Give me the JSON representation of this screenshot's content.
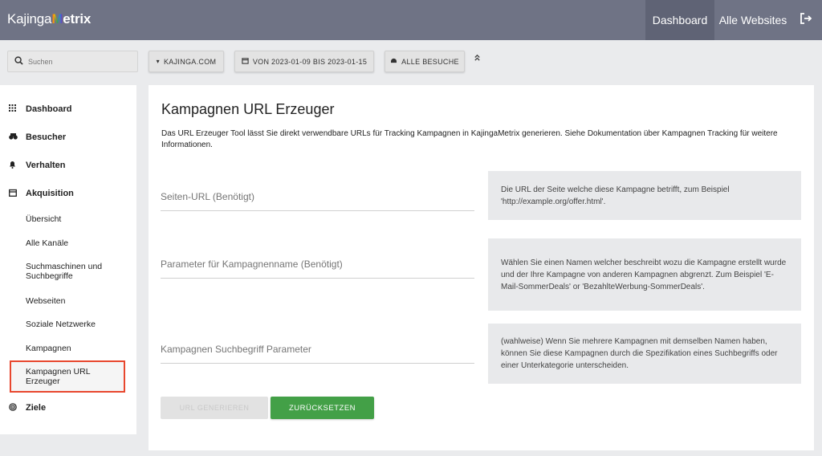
{
  "header": {
    "logo_prefix": "Kajinga",
    "logo_m": "M",
    "logo_rest": "etrix",
    "nav_dashboard": "Dashboard",
    "nav_all_websites": "Alle Websites"
  },
  "toolbar": {
    "search_placeholder": "Suchen",
    "site_selector": "KAJINGA.COM",
    "date_range": "VON 2023-01-09 BIS 2023-01-15",
    "segment": "ALLE BESUCHE"
  },
  "sidebar": {
    "dashboard": "Dashboard",
    "visitors": "Besucher",
    "behaviour": "Verhalten",
    "acquisition": "Akquisition",
    "sub_items": [
      "Übersicht",
      "Alle Kanäle",
      "Suchmaschinen und Suchbegriffe",
      "Webseiten",
      "Soziale Netzwerke",
      "Kampagnen",
      "Kampagnen URL Erzeuger"
    ],
    "goals": "Ziele"
  },
  "main": {
    "title": "Kampagnen URL Erzeuger",
    "intro": "Das URL Erzeuger Tool lässt Sie direkt verwendbare URLs für Tracking Kampagnen in KajingaMetrix generieren. Siehe Dokumentation über Kampagnen Tracking für weitere Informationen.",
    "fields": [
      {
        "placeholder": "Seiten-URL (Benötigt)",
        "help": "Die URL der Seite welche diese Kampagne betrifft, zum Beispiel 'http://example.org/offer.html'."
      },
      {
        "placeholder": "Parameter für Kampagnenname (Benötigt)",
        "help": "Wählen Sie einen Namen welcher beschreibt wozu die Kampagne erstellt wurde und der Ihre Kampagne von anderen Kampagnen abgrenzt. Zum Beispiel 'E-Mail-SommerDeals' or 'BezahlteWerbung-SommerDeals'."
      },
      {
        "placeholder": "Kampagnen Suchbegriff Parameter",
        "help": "(wahlweise) Wenn Sie mehrere Kampagnen mit demselben Namen haben, können Sie diese Kampagnen durch die Spezifikation eines Suchbegriffs oder einer Unterkategorie unterscheiden."
      }
    ],
    "generate_button": "URL GENERIEREN",
    "reset_button": "ZURÜCKSETZEN"
  },
  "colors": {
    "header_bg": "#6f7385",
    "accent_green": "#43a047",
    "active_outline": "#e8472e"
  }
}
